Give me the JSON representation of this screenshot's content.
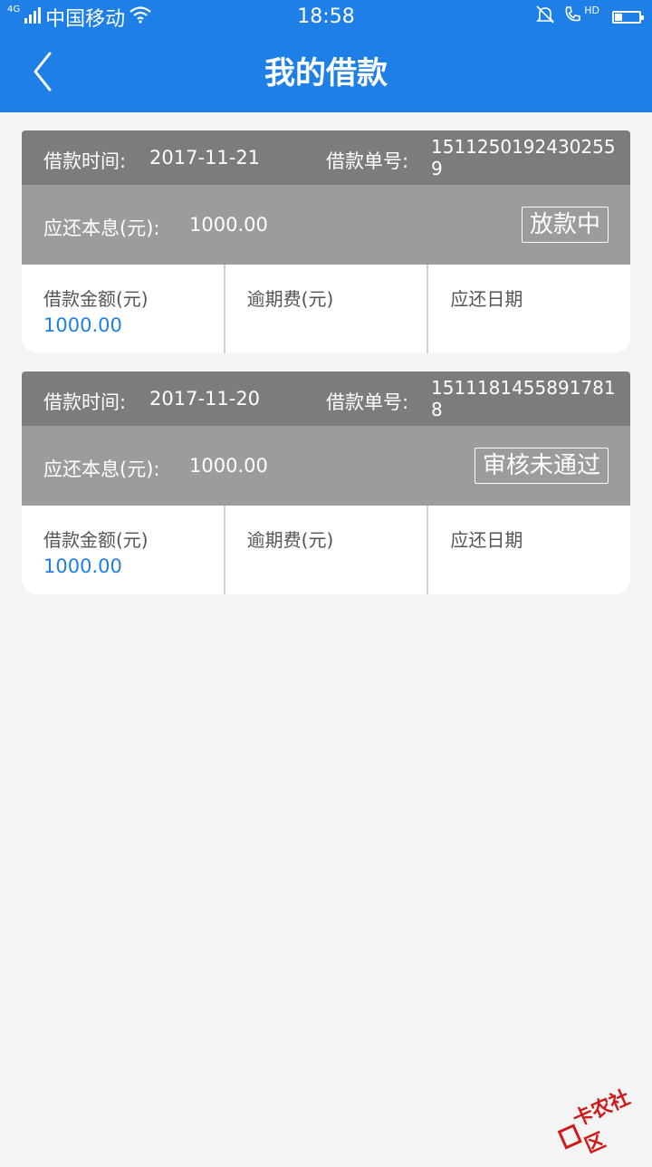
{
  "status_bar": {
    "network": "4G",
    "carrier": "中国移动",
    "time": "18:58",
    "hd_label": "HD",
    "battery_level": 0.3
  },
  "navbar": {
    "title": "我的借款",
    "back_icon": "chevron-left-icon"
  },
  "loans": [
    {
      "time_label": "借款时间:",
      "time_value": "2017-11-21",
      "no_label": "借款单号:",
      "no_value": "15112501924302559",
      "due_label": "应还本息(元):",
      "due_value": "1000.00",
      "status": "放款中",
      "amount_label": "借款金额(元)",
      "amount_value": "1000.00",
      "overdue_label": "逾期费(元)",
      "date_label": "应还日期"
    },
    {
      "time_label": "借款时间:",
      "time_value": "2017-11-20",
      "no_label": "借款单号:",
      "no_value": "15111814558917818",
      "due_label": "应还本息(元):",
      "due_value": "1000.00",
      "status": "审核未通过",
      "amount_label": "借款金额(元)",
      "amount_value": "1000.00",
      "overdue_label": "逾期费(元)",
      "date_label": "应还日期"
    }
  ],
  "watermark": {
    "text": "卡农社区"
  },
  "colors": {
    "brand": "#1e7fe6",
    "header_dark": "#7c7c7c",
    "header_light": "#9c9c9c",
    "accent_value": "#1e7fe6"
  }
}
